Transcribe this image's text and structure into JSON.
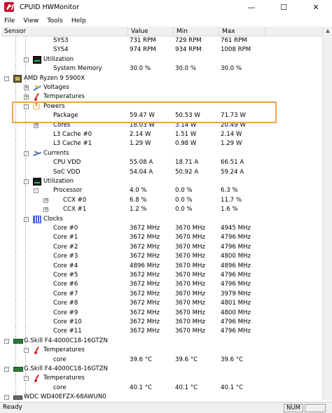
{
  "window": {
    "title": "CPUID HWMonitor",
    "minimize_glyph": "—",
    "maximize_glyph": "☐",
    "close_glyph": "✕"
  },
  "menu": [
    "File",
    "View",
    "Tools",
    "Help"
  ],
  "columns": {
    "sensor": "Sensor",
    "value": "Value",
    "min": "Min",
    "max": "Max"
  },
  "rows": [
    {
      "label": "SYS3",
      "value": "731 RPM",
      "min": "729 RPM",
      "max": "761 RPM",
      "indent": 74,
      "icon": "",
      "exp": ""
    },
    {
      "label": "SYS4",
      "value": "974 RPM",
      "min": "934 RPM",
      "max": "1008 RPM",
      "indent": 74,
      "icon": "",
      "exp": ""
    },
    {
      "label": "Utilization",
      "value": "",
      "min": "",
      "max": "",
      "indent": 60,
      "icon": "util",
      "exp": "-"
    },
    {
      "label": "System Memory",
      "value": "30.0 %",
      "min": "30.0 %",
      "max": "30.0 %",
      "indent": 74,
      "icon": "",
      "exp": ""
    },
    {
      "label": "AMD Ryzen 9 5900X",
      "value": "",
      "min": "",
      "max": "",
      "indent": 32,
      "icon": "cpu",
      "exp": "-"
    },
    {
      "label": "Voltages",
      "value": "",
      "min": "",
      "max": "",
      "indent": 60,
      "icon": "volt",
      "exp": "+"
    },
    {
      "label": "Temperatures",
      "value": "",
      "min": "",
      "max": "",
      "indent": 60,
      "icon": "temp",
      "exp": "+"
    },
    {
      "label": "Powers",
      "value": "",
      "min": "",
      "max": "",
      "indent": 60,
      "icon": "power",
      "exp": "-"
    },
    {
      "label": "Package",
      "value": "59.47 W",
      "min": "50.53 W",
      "max": "71.73 W",
      "indent": 74,
      "icon": "",
      "exp": ""
    },
    {
      "label": "Cores",
      "value": "18.03 W",
      "min": "3.14 W",
      "max": "20.49 W",
      "indent": 74,
      "icon": "",
      "exp": "+"
    },
    {
      "label": "L3 Cache #0",
      "value": "2.14 W",
      "min": "1.51 W",
      "max": "2.14 W",
      "indent": 74,
      "icon": "",
      "exp": ""
    },
    {
      "label": "L3 Cache #1",
      "value": "1.29 W",
      "min": "0.98 W",
      "max": "1.29 W",
      "indent": 74,
      "icon": "",
      "exp": ""
    },
    {
      "label": "Currents",
      "value": "",
      "min": "",
      "max": "",
      "indent": 60,
      "icon": "curr",
      "exp": "-"
    },
    {
      "label": "CPU VDD",
      "value": "55.08 A",
      "min": "18.71 A",
      "max": "66.51 A",
      "indent": 74,
      "icon": "",
      "exp": ""
    },
    {
      "label": "SoC VDD",
      "value": "54.04 A",
      "min": "50.92 A",
      "max": "59.24 A",
      "indent": 74,
      "icon": "",
      "exp": ""
    },
    {
      "label": "Utilization",
      "value": "",
      "min": "",
      "max": "",
      "indent": 60,
      "icon": "util",
      "exp": "-"
    },
    {
      "label": "Processor",
      "value": "4.0 %",
      "min": "0.0 %",
      "max": "6.3 %",
      "indent": 74,
      "icon": "",
      "exp": "-"
    },
    {
      "label": "CCX #0",
      "value": "6.8 %",
      "min": "0.0 %",
      "max": "11.7 %",
      "indent": 88,
      "icon": "",
      "exp": "+"
    },
    {
      "label": "CCX #1",
      "value": "1.2 %",
      "min": "0.0 %",
      "max": "1.6 %",
      "indent": 88,
      "icon": "",
      "exp": "+"
    },
    {
      "label": "Clocks",
      "value": "",
      "min": "",
      "max": "",
      "indent": 60,
      "icon": "clock",
      "exp": "-"
    },
    {
      "label": "Core #0",
      "value": "3672 MHz",
      "min": "3670 MHz",
      "max": "4945 MHz",
      "indent": 74,
      "icon": "",
      "exp": ""
    },
    {
      "label": "Core #1",
      "value": "3672 MHz",
      "min": "3670 MHz",
      "max": "4796 MHz",
      "indent": 74,
      "icon": "",
      "exp": ""
    },
    {
      "label": "Core #2",
      "value": "3672 MHz",
      "min": "3670 MHz",
      "max": "4796 MHz",
      "indent": 74,
      "icon": "",
      "exp": ""
    },
    {
      "label": "Core #3",
      "value": "3672 MHz",
      "min": "3670 MHz",
      "max": "4800 MHz",
      "indent": 74,
      "icon": "",
      "exp": ""
    },
    {
      "label": "Core #4",
      "value": "4896 MHz",
      "min": "3670 MHz",
      "max": "4896 MHz",
      "indent": 74,
      "icon": "",
      "exp": ""
    },
    {
      "label": "Core #5",
      "value": "3672 MHz",
      "min": "3670 MHz",
      "max": "4796 MHz",
      "indent": 74,
      "icon": "",
      "exp": ""
    },
    {
      "label": "Core #6",
      "value": "3672 MHz",
      "min": "3670 MHz",
      "max": "4796 MHz",
      "indent": 74,
      "icon": "",
      "exp": ""
    },
    {
      "label": "Core #7",
      "value": "3672 MHz",
      "min": "3670 MHz",
      "max": "3979 MHz",
      "indent": 74,
      "icon": "",
      "exp": ""
    },
    {
      "label": "Core #8",
      "value": "3672 MHz",
      "min": "3670 MHz",
      "max": "4801 MHz",
      "indent": 74,
      "icon": "",
      "exp": ""
    },
    {
      "label": "Core #9",
      "value": "3672 MHz",
      "min": "3670 MHz",
      "max": "4800 MHz",
      "indent": 74,
      "icon": "",
      "exp": ""
    },
    {
      "label": "Core #10",
      "value": "3672 MHz",
      "min": "3670 MHz",
      "max": "4796 MHz",
      "indent": 74,
      "icon": "",
      "exp": ""
    },
    {
      "label": "Core #11",
      "value": "3672 MHz",
      "min": "3670 MHz",
      "max": "4796 MHz",
      "indent": 74,
      "icon": "",
      "exp": ""
    },
    {
      "label": "G.Skill F4-4000C18-16GTZN",
      "value": "",
      "min": "",
      "max": "",
      "indent": 32,
      "icon": "mem",
      "exp": "-"
    },
    {
      "label": "Temperatures",
      "value": "",
      "min": "",
      "max": "",
      "indent": 60,
      "icon": "temp",
      "exp": "-"
    },
    {
      "label": "core",
      "value": "39.6 °C",
      "min": "39.6 °C",
      "max": "39.6 °C",
      "indent": 74,
      "icon": "",
      "exp": ""
    },
    {
      "label": "G.Skill F4-4000C18-16GTZN",
      "value": "",
      "min": "",
      "max": "",
      "indent": 32,
      "icon": "mem",
      "exp": "-"
    },
    {
      "label": "Temperatures",
      "value": "",
      "min": "",
      "max": "",
      "indent": 60,
      "icon": "temp",
      "exp": "-"
    },
    {
      "label": "core",
      "value": "40.1 °C",
      "min": "40.1 °C",
      "max": "40.1 °C",
      "indent": 74,
      "icon": "",
      "exp": ""
    },
    {
      "label": "WDC WD40EFZX-68AWUN0",
      "value": "",
      "min": "",
      "max": "",
      "indent": 32,
      "icon": "disk",
      "exp": "-"
    }
  ],
  "status": {
    "text": "Ready",
    "num": "NUM"
  },
  "highlight_color": "#f0a04b"
}
